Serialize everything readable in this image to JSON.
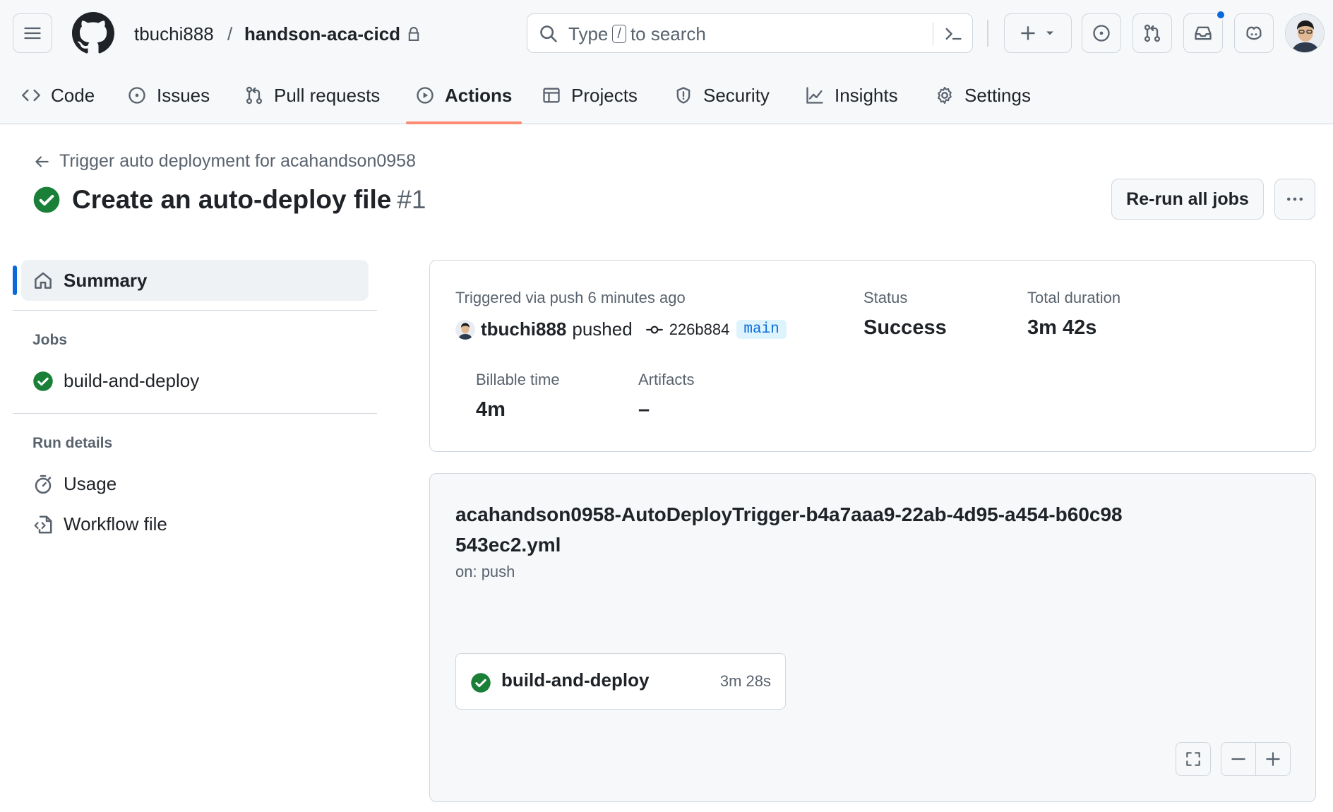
{
  "header": {
    "owner": "tbuchi888",
    "separator": "/",
    "repo": "handson-aca-cicd",
    "search": {
      "prefix": "Type",
      "key": "/",
      "suffix": "to search"
    }
  },
  "tabs": [
    {
      "label": "Code",
      "icon": "code-icon"
    },
    {
      "label": "Issues",
      "icon": "issue-icon"
    },
    {
      "label": "Pull requests",
      "icon": "pull-request-icon"
    },
    {
      "label": "Actions",
      "icon": "play-icon",
      "active": true
    },
    {
      "label": "Projects",
      "icon": "table-icon"
    },
    {
      "label": "Security",
      "icon": "shield-icon"
    },
    {
      "label": "Insights",
      "icon": "graph-icon"
    },
    {
      "label": "Settings",
      "icon": "gear-icon"
    }
  ],
  "run": {
    "back_label": "Trigger auto deployment for acahandson0958",
    "title": "Create an auto-deploy file",
    "number": "#1",
    "rerun_label": "Re-run all jobs"
  },
  "sidebar": {
    "summary_label": "Summary",
    "jobs_heading": "Jobs",
    "jobs": [
      {
        "label": "build-and-deploy",
        "status": "success"
      }
    ],
    "run_details_heading": "Run details",
    "run_details": [
      {
        "label": "Usage",
        "icon": "stopwatch-icon"
      },
      {
        "label": "Workflow file",
        "icon": "file-code-icon"
      }
    ]
  },
  "summary": {
    "trigger_text": "Triggered via push 6 minutes ago",
    "pusher": "tbuchi888",
    "pushed_word": "pushed",
    "commit_sha": "226b884",
    "branch": "main",
    "status_label": "Status",
    "status_value": "Success",
    "duration_label": "Total duration",
    "duration_value": "3m 42s",
    "billable_label": "Billable time",
    "billable_value": "4m",
    "artifacts_label": "Artifacts",
    "artifacts_value": "–"
  },
  "workflow": {
    "file_name": "acahandson0958-AutoDeployTrigger-b4a7aaa9-22ab-4d95-a454-b60c98543ec2.yml",
    "trigger": "on: push",
    "job": {
      "name": "build-and-deploy",
      "duration": "3m 28s"
    }
  },
  "colors": {
    "success": "#1a7f37",
    "accent": "#0969da",
    "tab_underline": "#fd8c73"
  }
}
